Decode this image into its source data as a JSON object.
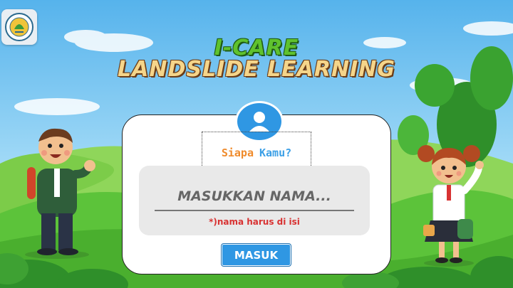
{
  "app": {
    "title_line1": "I-CARE",
    "title_line2": "LANDSLIDE LEARNING"
  },
  "logo": {
    "icon": "university-seal-icon"
  },
  "login": {
    "question_part1": "Siapa",
    "question_part2": "Kamu?",
    "name_placeholder": "MASUKKAN NAMA...",
    "required_note": "*)nama harus di isi",
    "submit_label": "MASUK"
  },
  "colors": {
    "sky_top": "#5fb8ee",
    "grass": "#5cc33a",
    "accent_blue": "#2f97e3",
    "warning_red": "#d83232",
    "title_green": "#5fc22e",
    "title_cream": "#f5d58a"
  }
}
